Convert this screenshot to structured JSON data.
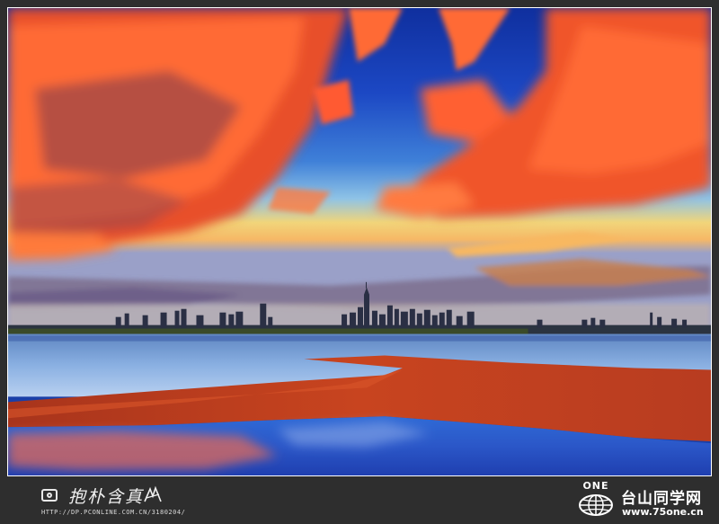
{
  "photo": {
    "subject": "city-skyline-at-sunset-over-bay",
    "colors": {
      "sky_top": "#1238b8",
      "sky_mid": "#3f78d6",
      "horizon_glow": "#f3d070",
      "cloud_orange": "#ff5a2a",
      "cloud_dark": "#6b3a5e",
      "water_blue": "#5a8fd6",
      "sand_red": "#c2401e"
    }
  },
  "watermark_left": {
    "icon": "camera-icon",
    "signature": "抱朴含真",
    "url": "HTTP://DP.PCONLINE.COM.CN/3180204/"
  },
  "watermark_right": {
    "logo_text": "ONE",
    "logo_icon": "globe-icon",
    "site_name": "台山同学网",
    "site_url": "www.75one.cn"
  }
}
